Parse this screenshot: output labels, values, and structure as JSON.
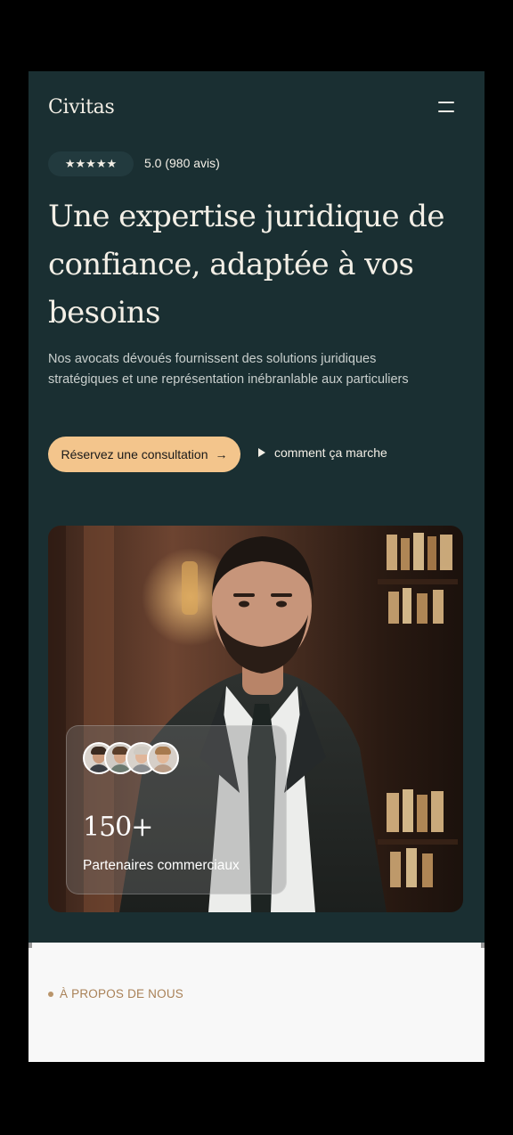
{
  "brand": {
    "logo": "Civitas"
  },
  "rating": {
    "stars": "★★★★★",
    "text": "5.0 (980 avis)"
  },
  "hero": {
    "headline": "Une expertise juridique de confiance, adaptée à vos besoins",
    "subtext": "Nos avocats dévoués fournissent des solutions juridiques stratégiques et une représentation inébranlable aux particuliers",
    "cta_label": "Réservez une consultation",
    "cta_arrow": "→",
    "secondary_label": "comment ça marche"
  },
  "stats": {
    "number": "150+",
    "label": "Partenaires commerciaux"
  },
  "about": {
    "eyebrow": "À PROPOS DE NOUS"
  },
  "colors": {
    "background": "#1a2f32",
    "accent": "#f3c58c",
    "eyebrow": "#a98157"
  }
}
